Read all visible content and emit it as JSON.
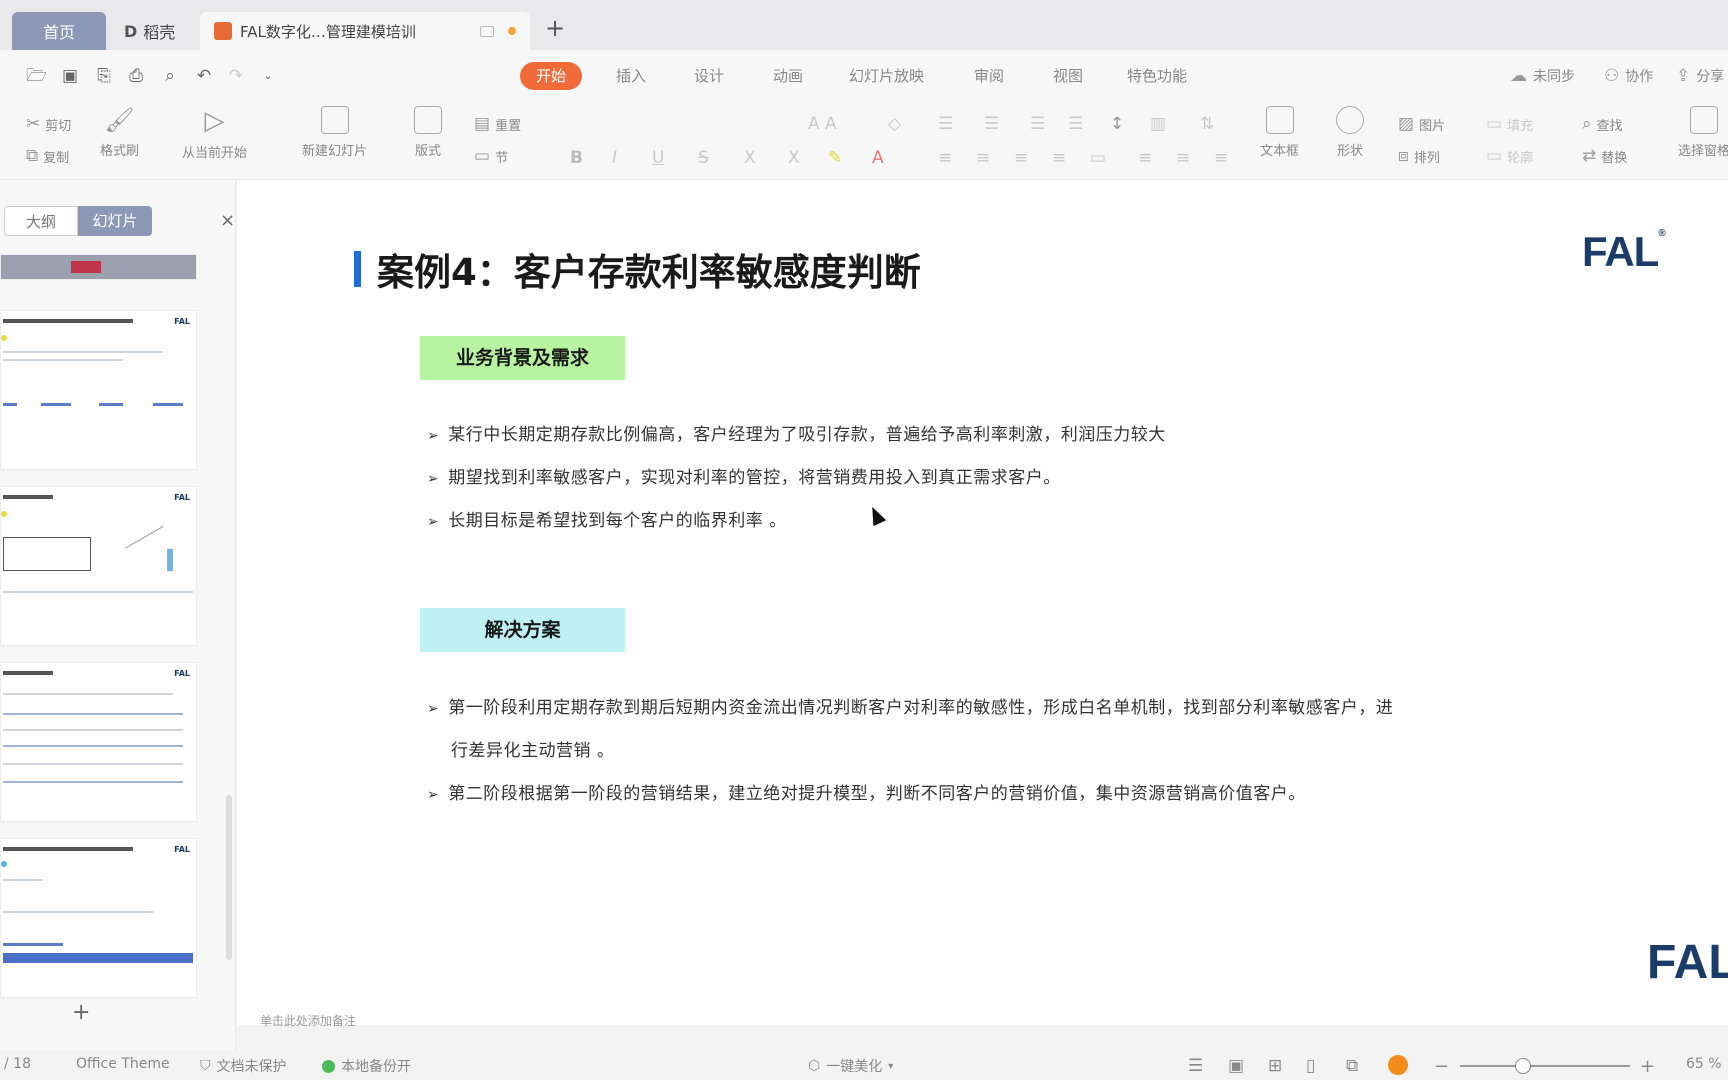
{
  "tabs": {
    "home": "首页",
    "daoke": "稻壳",
    "document": "FAL数字化…管理建模培训"
  },
  "menus": [
    "开始",
    "插入",
    "设计",
    "动画",
    "幻灯片放映",
    "审阅",
    "视图",
    "特色功能"
  ],
  "right_actions": {
    "sync": "未同步",
    "collab": "协作",
    "share": "分享"
  },
  "ribbon": {
    "cut": "剪切",
    "copy": "复制",
    "format_painter": "格式刷",
    "from_current": "从当前开始",
    "new_slide": "新建幻灯片",
    "layout": "版式",
    "reset": "重置",
    "section": "节",
    "textbox": "文本框",
    "shape": "形状",
    "picture": "图片",
    "arrange": "排列",
    "fill": "填充",
    "outline": "轮廓",
    "find": "查找",
    "replace": "替换",
    "select": "选择窗格"
  },
  "panel": {
    "outline_tab": "大纲",
    "slides_tab": "幻灯片"
  },
  "slide": {
    "title": "案例4：客户存款利率敏感度判断",
    "logo": "FAL",
    "section1": "业务背景及需求",
    "bullets1": [
      "某行中长期定期存款比例偏高，客户经理为了吸引存款，普遍给予高利率刺激，利润压力较大",
      "期望找到利率敏感客户，实现对利率的管控，将营销费用投入到真正需求客户。",
      "长期目标是希望找到每个客户的临界利率 。"
    ],
    "section2": "解决方案",
    "bullets2_line1": "第一阶段利用定期存款到期后短期内资金流出情况判断客户对利率的敏感性，形成白名单机制，找到部分利率敏感客户，进",
    "bullets2_line1b": "行差异化主动营销 。",
    "bullets2_line2": "第二阶段根据第一阶段的营销结果，建立绝对提升模型，判断不同客户的营销价值，集中资源营销高价值客户。"
  },
  "notes_placeholder": "单击此处添加备注",
  "status": {
    "page": "/ 18",
    "theme": "Office Theme",
    "protect": "文档未保护",
    "backup": "本地备份开",
    "beautify": "一键美化",
    "zoom": "65 %"
  }
}
